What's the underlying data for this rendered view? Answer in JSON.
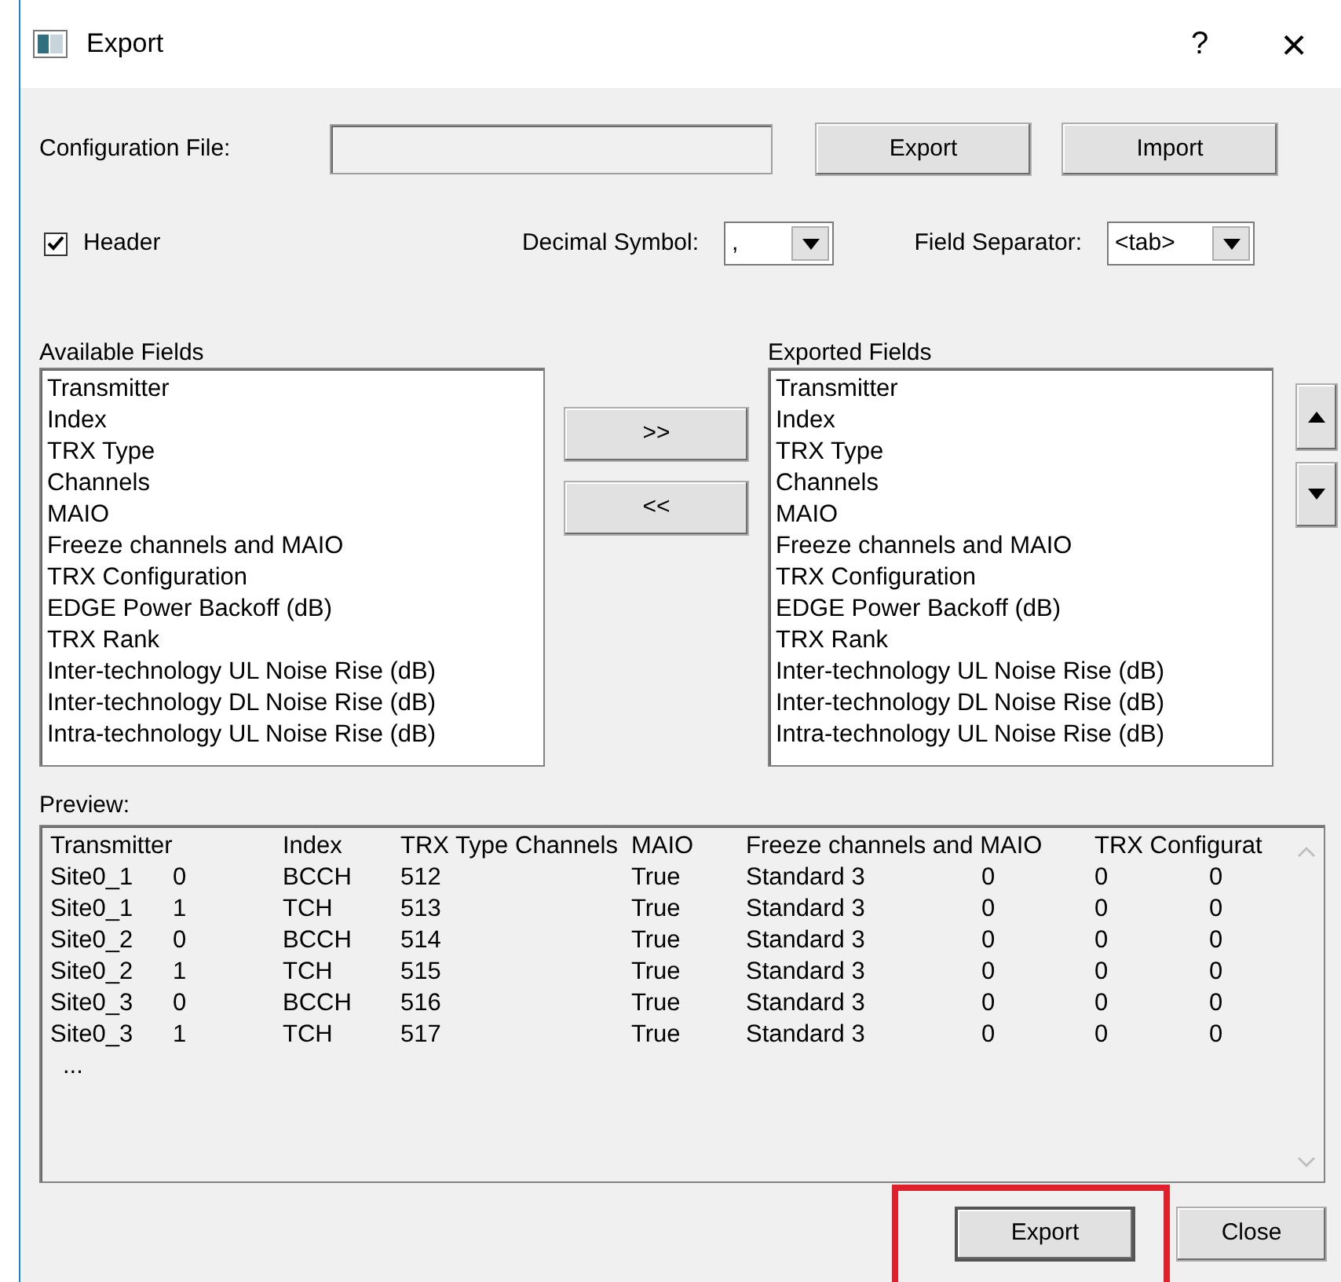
{
  "window": {
    "title": "Export",
    "help": "?",
    "close": "×"
  },
  "config": {
    "label": "Configuration File:",
    "buttons": [
      {
        "label": "Export"
      },
      {
        "label": "Import"
      }
    ]
  },
  "header_option": {
    "label": "Header",
    "checked": true
  },
  "decimal_symbol": {
    "label": "Decimal Symbol:",
    "value": ","
  },
  "field_separator": {
    "label": "Field Separator:",
    "value": "<tab>"
  },
  "available_fields": {
    "label": "Available Fields",
    "items": [
      "Transmitter",
      "Index",
      "TRX Type",
      "Channels",
      "MAIO",
      "Freeze channels and MAIO",
      "TRX Configuration",
      "EDGE Power Backoff (dB)",
      "TRX Rank",
      "Inter-technology UL Noise Rise (dB)",
      "Inter-technology DL Noise Rise (dB)",
      "Intra-technology UL Noise Rise (dB)"
    ]
  },
  "move_buttons": [
    ">>",
    "<<"
  ],
  "exported_fields": {
    "label": "Exported Fields",
    "items": [
      "Transmitter",
      "Index",
      "TRX Type",
      "Channels",
      "MAIO",
      "Freeze channels and MAIO",
      "TRX Configuration",
      "EDGE Power Backoff (dB)",
      "TRX Rank",
      "Inter-technology UL Noise Rise (dB)",
      "Inter-technology DL Noise Rise (dB)",
      "Intra-technology UL Noise Rise (dB)"
    ]
  },
  "preview": {
    "label": "Preview:",
    "header": [
      "Transmitter",
      "Index",
      "TRX Type",
      "Channels",
      "MAIO",
      "Freeze channels and MAIO",
      "TRX Configurat"
    ],
    "rows": [
      [
        "Site0_1",
        "0",
        "BCCH",
        "512",
        "True",
        "Standard 3",
        "0",
        "0",
        "0"
      ],
      [
        "Site0_1",
        "1",
        "TCH",
        "513",
        "True",
        "Standard 3",
        "0",
        "0",
        "0"
      ],
      [
        "Site0_2",
        "0",
        "BCCH",
        "514",
        "True",
        "Standard 3",
        "0",
        "0",
        "0"
      ],
      [
        "Site0_2",
        "1",
        "TCH",
        "515",
        "True",
        "Standard 3",
        "0",
        "0",
        "0"
      ],
      [
        "Site0_3",
        "0",
        "BCCH",
        "516",
        "True",
        "Standard 3",
        "0",
        "0",
        "0"
      ],
      [
        "Site0_3",
        "1",
        "TCH",
        "517",
        "True",
        "Standard 3",
        "0",
        "0",
        "0"
      ]
    ],
    "more": "..."
  },
  "footer_buttons": [
    {
      "label": "Export",
      "highlighted": true
    },
    {
      "label": "Close",
      "highlighted": false
    }
  ]
}
